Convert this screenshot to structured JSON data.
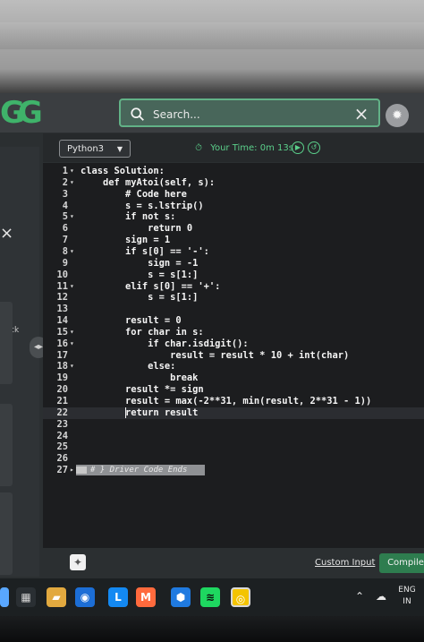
{
  "header": {
    "logo_text": "GG",
    "search_placeholder": "Search...",
    "close_label": "×",
    "theme_icon": "sun-icon"
  },
  "left_panel": {
    "close_label": "×",
    "back_label": "eack"
  },
  "editor_toolbar": {
    "language": "Python3",
    "timer_label": "Your Time: 0m 13s"
  },
  "code_editor": {
    "lines": [
      {
        "n": "1",
        "fold": "▾",
        "text": "class Solution:"
      },
      {
        "n": "2",
        "fold": "▾",
        "text": "    def myAtoi(self, s):"
      },
      {
        "n": "3",
        "fold": "",
        "text": "        # Code here"
      },
      {
        "n": "4",
        "fold": "",
        "text": "        s = s.lstrip()"
      },
      {
        "n": "5",
        "fold": "▾",
        "text": "        if not s:"
      },
      {
        "n": "6",
        "fold": "",
        "text": "            return 0"
      },
      {
        "n": "7",
        "fold": "",
        "text": "        sign = 1"
      },
      {
        "n": "8",
        "fold": "▾",
        "text": "        if s[0] == '-':"
      },
      {
        "n": "9",
        "fold": "",
        "text": "            sign = -1"
      },
      {
        "n": "10",
        "fold": "",
        "text": "            s = s[1:]"
      },
      {
        "n": "11",
        "fold": "▾",
        "text": "        elif s[0] == '+':"
      },
      {
        "n": "12",
        "fold": "",
        "text": "            s = s[1:]"
      },
      {
        "n": "13",
        "fold": "",
        "text": ""
      },
      {
        "n": "14",
        "fold": "",
        "text": "        result = 0"
      },
      {
        "n": "15",
        "fold": "▾",
        "text": "        for char in s:"
      },
      {
        "n": "16",
        "fold": "▾",
        "text": "            if char.isdigit():"
      },
      {
        "n": "17",
        "fold": "",
        "text": "                result = result * 10 + int(char)"
      },
      {
        "n": "18",
        "fold": "▾",
        "text": "            else:"
      },
      {
        "n": "19",
        "fold": "",
        "text": "                break"
      },
      {
        "n": "20",
        "fold": "",
        "text": "        result *= sign"
      },
      {
        "n": "21",
        "fold": "",
        "text": "        result = max(-2**31, min(result, 2**31 - 1))"
      },
      {
        "n": "22",
        "fold": "",
        "text": "        return result"
      },
      {
        "n": "23",
        "fold": "",
        "text": ""
      },
      {
        "n": "24",
        "fold": "",
        "text": ""
      },
      {
        "n": "25",
        "fold": "",
        "text": ""
      },
      {
        "n": "26",
        "fold": "",
        "text": ""
      },
      {
        "n": "27",
        "fold": "▸",
        "text": ""
      }
    ],
    "driver_code_label": "# } Driver Code Ends"
  },
  "bottom_actions": {
    "custom_input_label": "Custom Input",
    "compile_label": "Compile &"
  },
  "taskbar": {
    "tray_language_line1": "ENG",
    "tray_language_line2": "IN"
  },
  "colors": {
    "accent_green": "#5bd08b",
    "search_border": "#62b287"
  }
}
